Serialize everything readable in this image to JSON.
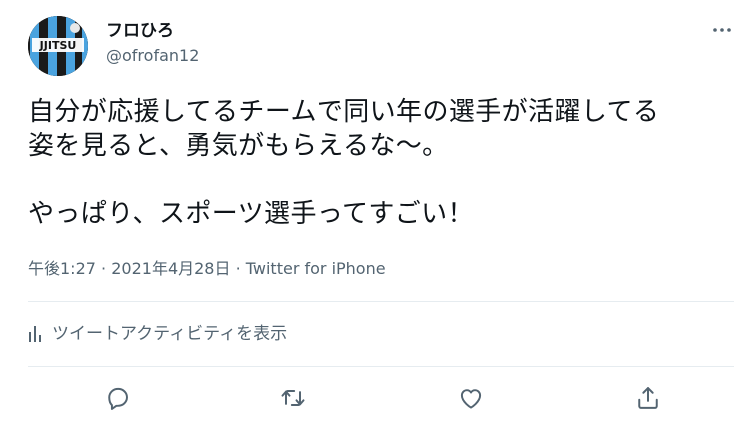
{
  "user": {
    "display_name": "フロひろ",
    "handle": "@ofrofan12",
    "avatar_text": "JJITSU"
  },
  "tweet": {
    "text": "自分が応援してるチームで同い年の選手が活躍してる\n姿を見ると、勇気がもらえるな〜。\n\nやっぱり、スポーツ選手ってすごい！",
    "time": "午後1:27",
    "separator": "·",
    "date": "2021年4月28日",
    "source": "Twitter for iPhone"
  },
  "activity": {
    "label": "ツイートアクティビティを表示"
  },
  "icons": {
    "more": "more-icon",
    "reply": "reply-icon",
    "retweet": "retweet-icon",
    "like": "like-icon",
    "share": "share-icon",
    "activity": "bar-chart-icon"
  },
  "colors": {
    "text_primary": "#0f1419",
    "text_secondary": "#536471",
    "divider": "#e6ecf0",
    "avatar_stripe_blue": "#4aa3df",
    "avatar_stripe_dark": "#1a1a1a"
  }
}
